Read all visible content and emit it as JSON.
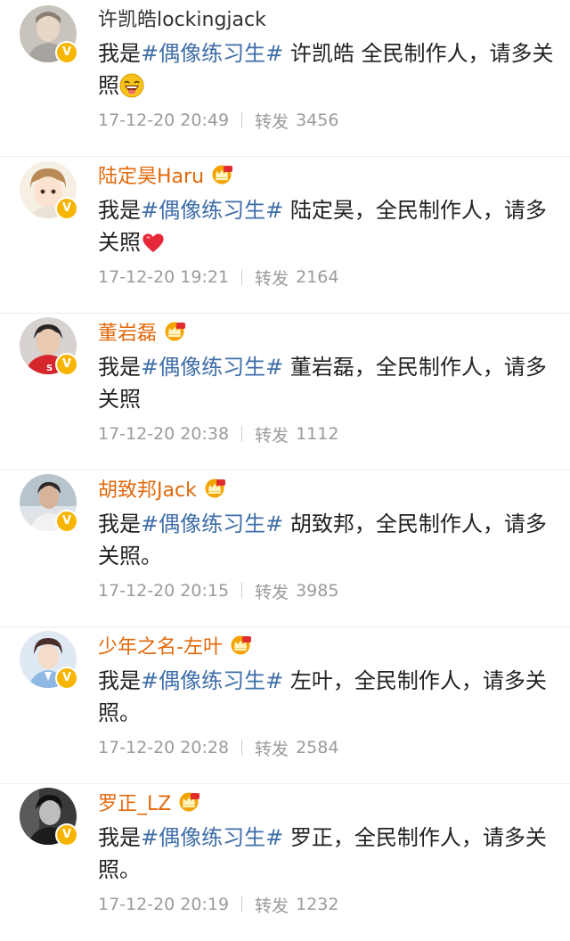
{
  "feed": {
    "posts": [
      {
        "username": "许凯皓lockingjack",
        "vip": false,
        "prefix": "我是",
        "hashtag": "#偶像练习生#",
        "body": " 许凯皓 全民制作人，请多关照",
        "emoji": "grinning-face-emoji",
        "time": "17-12-20 20:49",
        "repost_label": "转发",
        "repost_count": "3456"
      },
      {
        "username": "陆定昊Haru",
        "vip": true,
        "prefix": "我是",
        "hashtag": "#偶像练习生#",
        "body": " 陆定昊，全民制作人，请多关照",
        "emoji": "red-heart-emoji",
        "time": "17-12-20 19:21",
        "repost_label": "转发",
        "repost_count": "2164"
      },
      {
        "username": "董岩磊",
        "vip": true,
        "prefix": "我是",
        "hashtag": "#偶像练习生#",
        "body": " 董岩磊，全民制作人，请多关照",
        "emoji": "",
        "time": "17-12-20 20:38",
        "repost_label": "转发",
        "repost_count": "1112"
      },
      {
        "username": "胡致邦Jack",
        "vip": true,
        "prefix": "我是",
        "hashtag": "#偶像练习生#",
        "body": " 胡致邦，全民制作人，请多关照。",
        "emoji": "",
        "time": "17-12-20 20:15",
        "repost_label": "转发",
        "repost_count": "3985"
      },
      {
        "username": "少年之名-左叶",
        "vip": true,
        "prefix": "我是",
        "hashtag": "#偶像练习生#",
        "body": " 左叶，全民制作人，请多关照。",
        "emoji": "",
        "time": "17-12-20 20:28",
        "repost_label": "转发",
        "repost_count": "2584"
      },
      {
        "username": "罗正_LZ",
        "vip": true,
        "prefix": "我是",
        "hashtag": "#偶像练习生#",
        "body": " 罗正，全民制作人，请多关照。",
        "emoji": "",
        "time": "17-12-20 20:19",
        "repost_label": "转发",
        "repost_count": "1232"
      }
    ]
  },
  "icons": {
    "verified_badge": "verified-v-icon",
    "vip_badge": "vip-crown-icon",
    "avatar": "avatar-photo"
  },
  "colors": {
    "vip_username": "#e2690c",
    "plain_username": "#333333",
    "hashtag": "#3f6ea8",
    "meta_text": "#9b9b9b",
    "verified_badge": "#f7b500",
    "divider": "#ececec"
  }
}
